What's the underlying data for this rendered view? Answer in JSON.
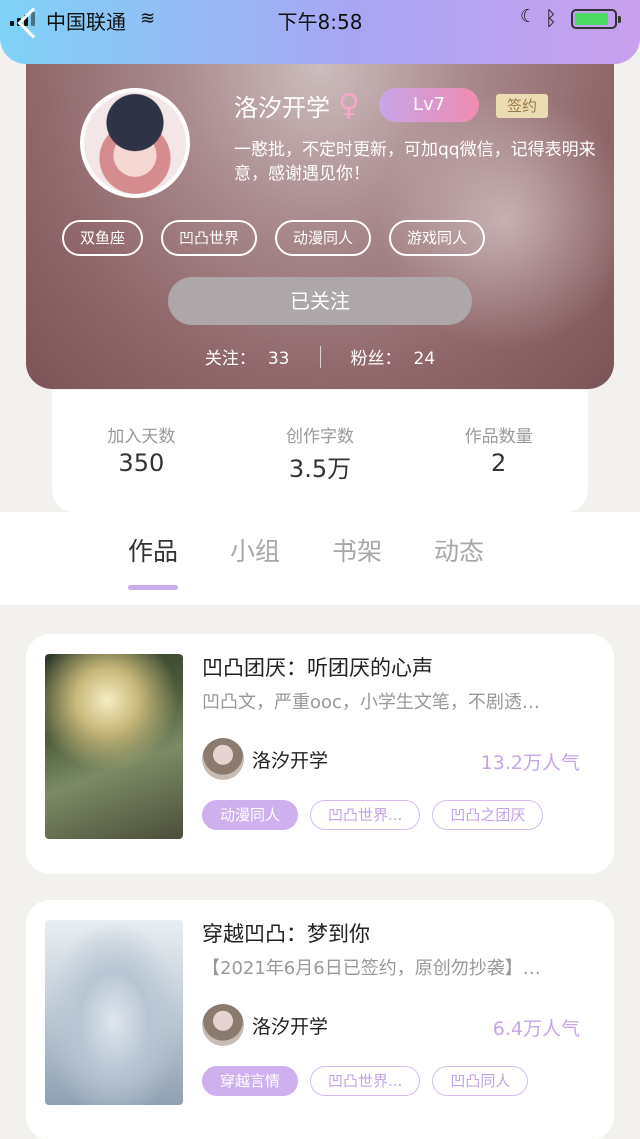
{
  "status_bar": {
    "carrier": "中国联通",
    "time": "下午8:58",
    "battery_level": 0.86
  },
  "profile": {
    "name": "洛汐开学",
    "gender_symbol": "♀",
    "level": "Lv7",
    "signed_badge": "签约",
    "bio": "一憨批，不定时更新，可加qq微信，记得表明来意，感谢遇见你！",
    "tags": [
      "双鱼座",
      "凹凸世界",
      "动漫同人",
      "游戏同人"
    ],
    "follow_button": "已关注",
    "following_label": "关注：",
    "following_count": "33",
    "fans_label": "粉丝：",
    "fans_count": "24"
  },
  "stats": [
    {
      "label": "加入天数",
      "value": "350"
    },
    {
      "label": "创作字数",
      "value": "3.5万"
    },
    {
      "label": "作品数量",
      "value": "2"
    }
  ],
  "tabs": [
    "作品",
    "小组",
    "书架",
    "动态"
  ],
  "books": [
    {
      "title": "凹凸团厌：听团厌的心声",
      "desc": "凹凸文，严重ooc，小学生文笔，不剧透…",
      "author": "洛汐开学",
      "popularity": "13.2万人气",
      "tags": [
        "动漫同人",
        "凹凸世界...",
        "凹凸之团厌"
      ]
    },
    {
      "title": "穿越凹凸：梦到你",
      "desc": "【2021年6月6日已签约，原创勿抄袭】…",
      "author": "洛汐开学",
      "popularity": "6.4万人气",
      "tags": [
        "穿越言情",
        "凹凸世界...",
        "凹凸同人"
      ]
    }
  ],
  "colors": {
    "accent_purple": "#c9aee9",
    "status_gradient_start": "#7fd3f7",
    "status_gradient_end": "#c9a0ee"
  }
}
